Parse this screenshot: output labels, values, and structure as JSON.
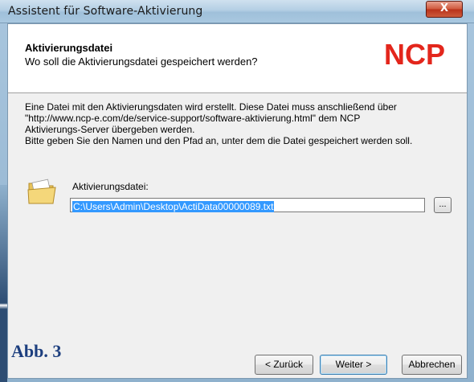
{
  "window": {
    "title": "Assistent für Software-Aktivierung",
    "close_label": "X"
  },
  "header": {
    "title": "Aktivierungsdatei",
    "subtitle": "Wo soll die Aktivierungsdatei gespeichert werden?",
    "logo_text": "NCP",
    "logo_color": "#e3261c"
  },
  "description": {
    "lines": [
      "Eine Datei mit den Aktivierungsdaten wird erstellt. Diese Datei muss anschließend über",
      "\"http://www.ncp-e.com/de/service-support/software-aktivierung.html\" dem NCP",
      "Aktivierungs-Server übergeben werden.",
      "Bitte geben Sie den Namen und den Pfad an, unter dem die Datei gespeichert werden soll."
    ]
  },
  "file_field": {
    "label": "Aktivierungsdatei:",
    "value": "C:\\Users\\Admin\\Desktop\\ActiData00000089.txt",
    "browse_label": "..."
  },
  "caption": "Abb. 3",
  "buttons": {
    "back": "< Zurück",
    "next": "Weiter >",
    "cancel": "Abbrechen"
  }
}
